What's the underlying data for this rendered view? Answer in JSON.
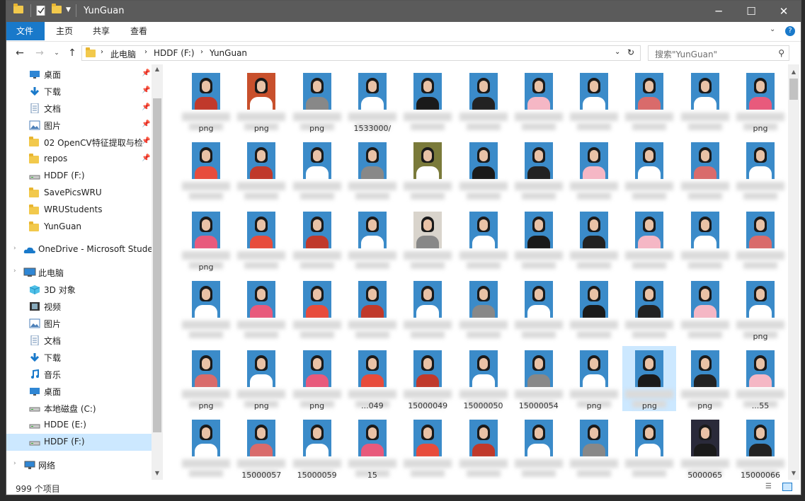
{
  "window": {
    "title": "YunGuan"
  },
  "ribbon": {
    "tabs": [
      "文件",
      "主页",
      "共享",
      "查看"
    ]
  },
  "address": {
    "crumbs": [
      "此电脑",
      "HDDF (F:)",
      "YunGuan"
    ],
    "search_placeholder": "搜索\"YunGuan\""
  },
  "nav": {
    "quick": [
      {
        "label": "桌面",
        "icon": "desktop-icon"
      },
      {
        "label": "下载",
        "icon": "download-icon"
      },
      {
        "label": "文档",
        "icon": "document-icon"
      },
      {
        "label": "图片",
        "icon": "picture-icon"
      },
      {
        "label": "02 OpenCV特征提取与检",
        "icon": "folder-icon"
      },
      {
        "label": "repos",
        "icon": "folder-icon"
      },
      {
        "label": "HDDF (F:)",
        "icon": "drive-icon"
      },
      {
        "label": "SavePicsWRU",
        "icon": "folder-icon"
      },
      {
        "label": "WRUStudents",
        "icon": "folder-icon"
      },
      {
        "label": "YunGuan",
        "icon": "folder-icon"
      }
    ],
    "onedrive": "OneDrive - Microsoft Stude",
    "this_pc": "此电脑",
    "pc_items": [
      {
        "label": "3D 对象",
        "icon": "3d-objects-icon"
      },
      {
        "label": "视频",
        "icon": "video-icon"
      },
      {
        "label": "图片",
        "icon": "picture-icon"
      },
      {
        "label": "文档",
        "icon": "document-icon"
      },
      {
        "label": "下载",
        "icon": "download-icon"
      },
      {
        "label": "音乐",
        "icon": "music-icon"
      },
      {
        "label": "桌面",
        "icon": "desktop-icon"
      },
      {
        "label": "本地磁盘 (C:)",
        "icon": "drive-icon"
      },
      {
        "label": "HDDE (E:)",
        "icon": "drive-icon"
      },
      {
        "label": "HDDF (F:)",
        "icon": "drive-icon"
      }
    ],
    "network": "网络"
  },
  "grid": {
    "visible_names": {
      "0": "png",
      "1": "png",
      "2": "png",
      "3": "1533000/",
      "10": "png",
      "22": "png",
      "43": "png",
      "44": "png",
      "45": "png",
      "46": "png",
      "47": "...049",
      "48": "15000049",
      "49": "15000050",
      "50": "15000054",
      "51": "png",
      "52": "png",
      "53": "png",
      "54": "...55",
      "56": "15000057",
      "57": "15000059",
      "58": "15",
      "64": "5000065",
      "65": "15000066"
    },
    "selected_index": 52
  },
  "status": {
    "count": "999 个项目"
  },
  "colors": {
    "accent": "#1979ca",
    "selection": "#cce8ff",
    "photo_bg": "#3b8bc9"
  }
}
